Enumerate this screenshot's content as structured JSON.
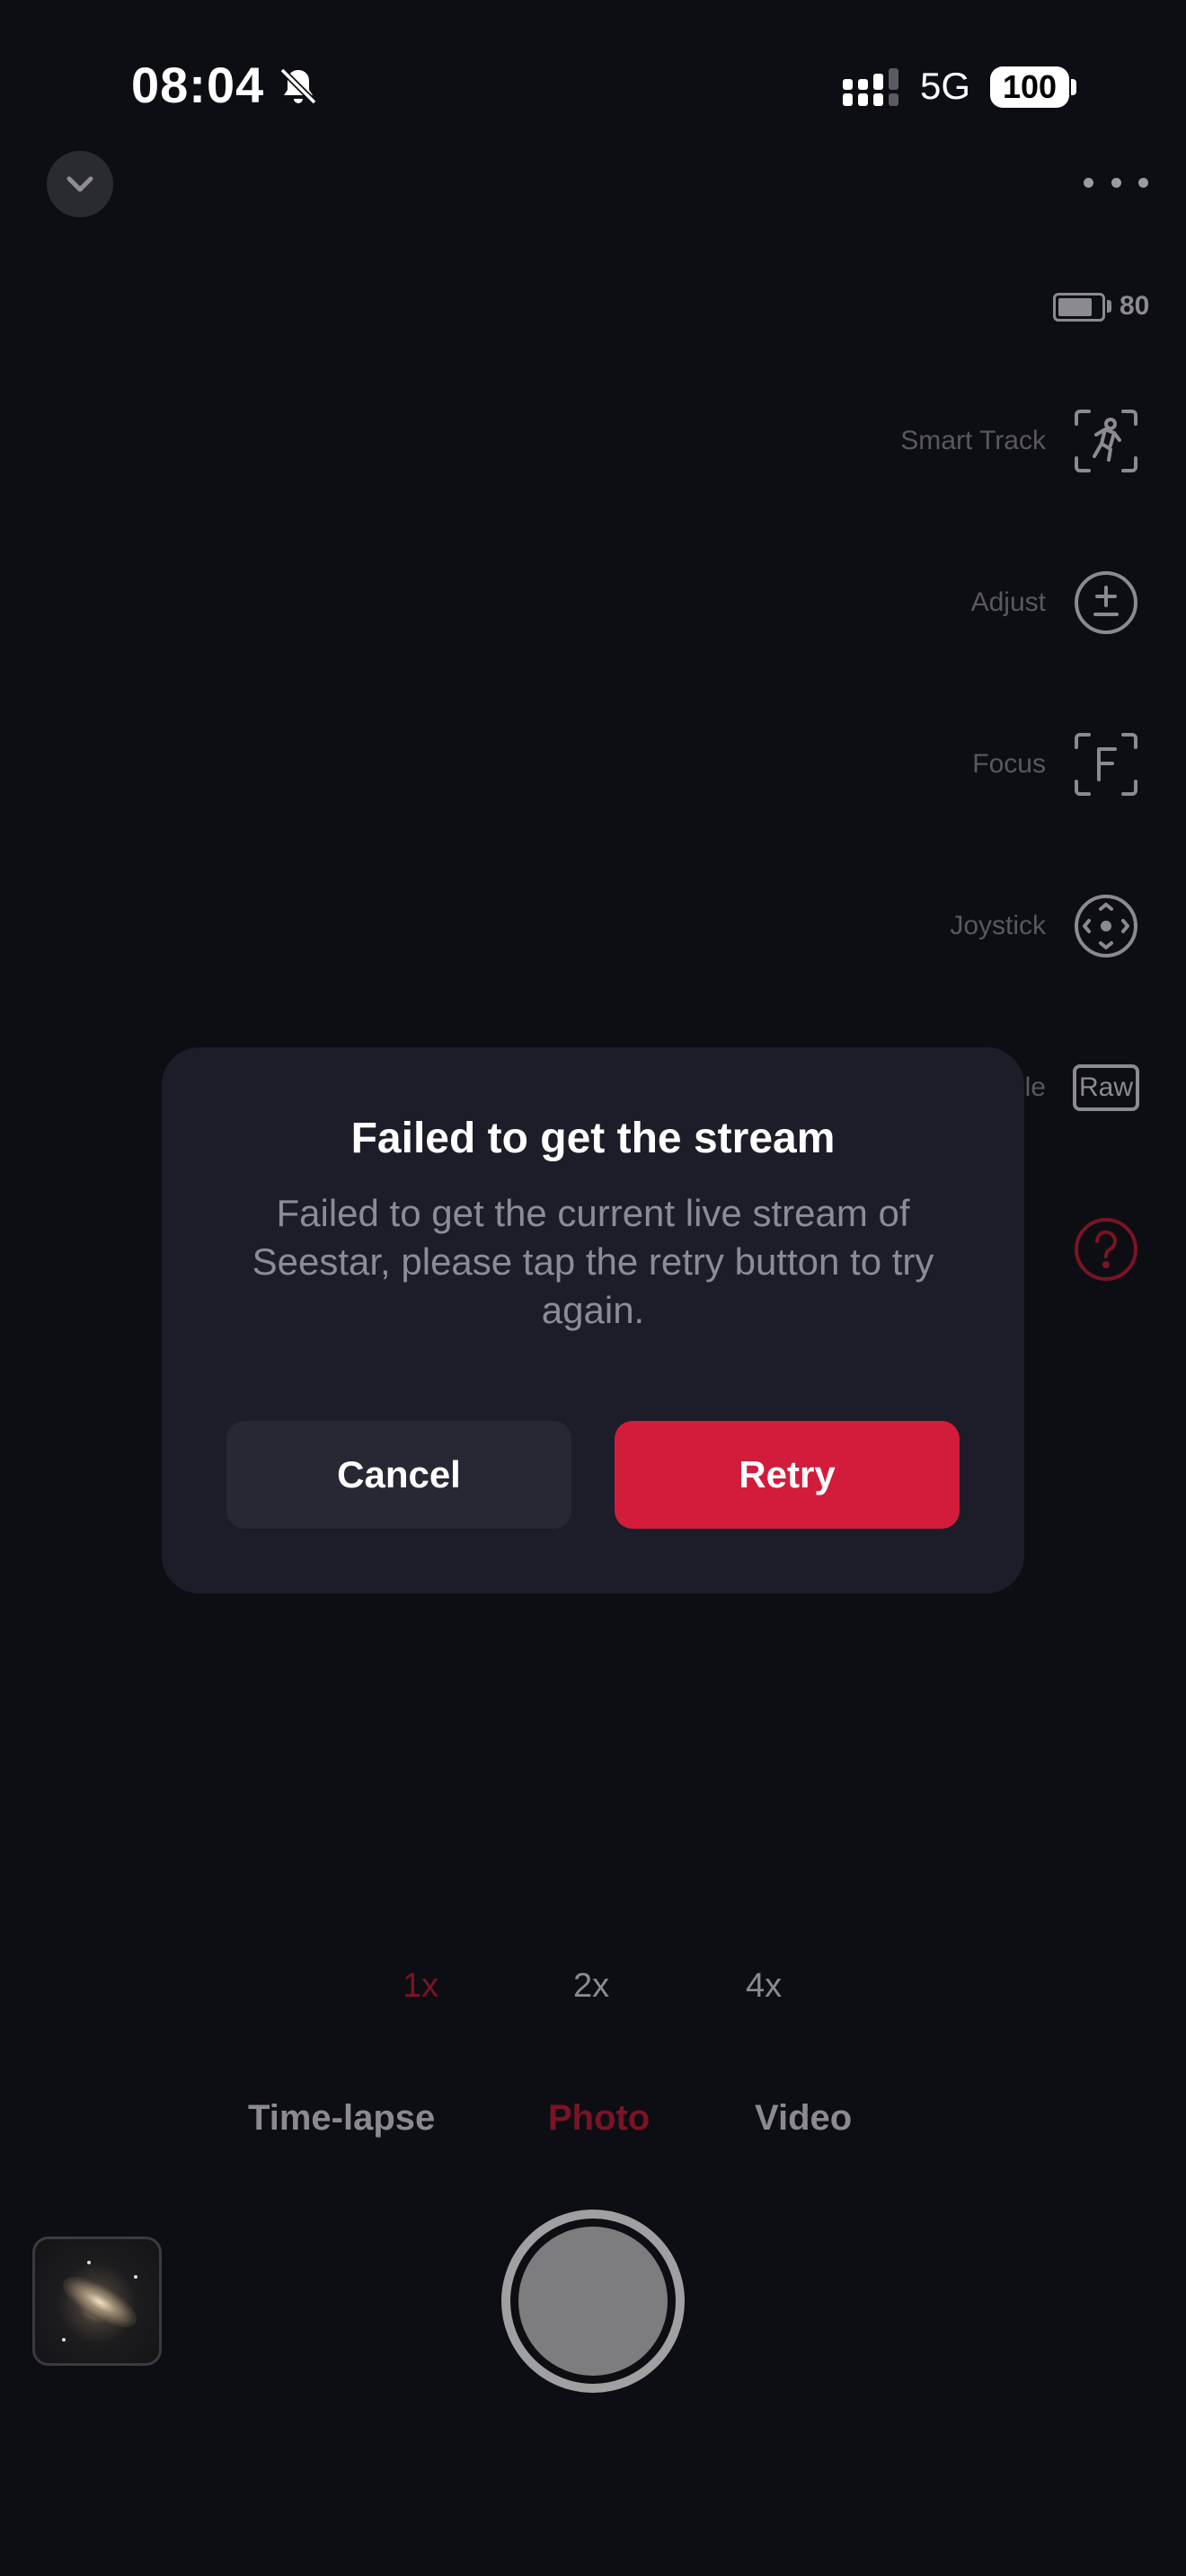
{
  "status_bar": {
    "time": "08:04",
    "network": "5G",
    "battery": "100"
  },
  "device": {
    "battery_level": "80"
  },
  "tools": {
    "smart_track": "Smart Track",
    "adjust": "Adjust",
    "focus": "Focus",
    "joystick": "Joystick",
    "raw_label": "le",
    "raw_icon_text": "Raw"
  },
  "dialog": {
    "title": "Failed to get the stream",
    "message": "Failed to get the current live stream of Seestar, please tap the retry button to try again.",
    "cancel_label": "Cancel",
    "retry_label": "Retry"
  },
  "zoom": {
    "options": [
      "1x",
      "2x",
      "4x"
    ],
    "selected": "1x"
  },
  "modes": {
    "options": [
      "Time-lapse",
      "Photo",
      "Video"
    ],
    "selected": "Photo"
  },
  "colors": {
    "accent": "#d31c3c",
    "accent_dim": "#7a1424",
    "background": "#0d0e13",
    "dialog": "#1c1d29"
  },
  "icons": {
    "bell": "bell-slash-icon",
    "collapse": "chevron-down-icon",
    "more": "more-icon",
    "smart_track": "running-person-icon",
    "adjust": "plus-minus-icon",
    "focus": "focus-f-icon",
    "joystick": "joystick-icon",
    "help": "question-mark-icon"
  }
}
